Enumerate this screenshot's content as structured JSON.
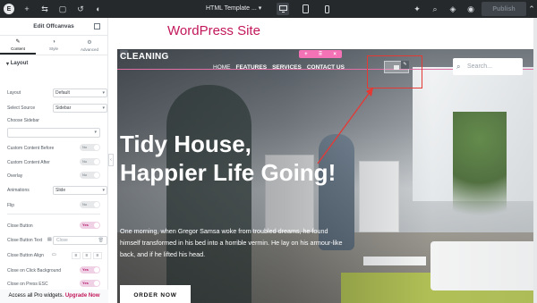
{
  "topbar": {
    "logo": "E",
    "title": "HTML Template ...",
    "publish_label": "Publish",
    "icons": [
      "elementor-logo-icon",
      "add-icon",
      "settings-sliders-icon",
      "page-icon",
      "history-icon",
      "contrast-icon",
      "desktop-icon",
      "tablet-icon",
      "mobile-icon",
      "notifications-icon",
      "search-icon",
      "layers-icon",
      "preview-eye-icon"
    ]
  },
  "panel": {
    "title": "Edit Offcanvas",
    "tabs": [
      {
        "label": "Content"
      },
      {
        "label": "Style"
      },
      {
        "label": "Advanced"
      }
    ],
    "section": "Layout",
    "rows": {
      "layout": {
        "label": "Layout",
        "value": "Default"
      },
      "select_source": {
        "label": "Select Source",
        "value": "Sidebar"
      },
      "choose_sidebar": {
        "label": "Choose Sidebar"
      },
      "custom_before": {
        "label": "Custom Content Before",
        "value": "No"
      },
      "custom_after": {
        "label": "Custom Content After",
        "value": "No"
      },
      "overlay": {
        "label": "Overlay",
        "value": "No"
      },
      "animations": {
        "label": "Animations",
        "value": "Slide"
      },
      "flip": {
        "label": "Flip",
        "value": "No"
      },
      "close_button": {
        "label": "Close Button",
        "value": "Yes"
      },
      "close_button_text": {
        "label": "Close Button Text",
        "placeholder": "Close"
      },
      "close_button_align": {
        "label": "Close Button Align"
      },
      "close_on_click_bg": {
        "label": "Close on Click Background",
        "value": "Yes"
      },
      "close_on_esc": {
        "label": "Close on Press ESC",
        "value": "Yes"
      }
    },
    "promo_text": "Access all Pro widgets.",
    "promo_link": "Upgrade Now"
  },
  "preview": {
    "label": "WordPress Site",
    "site_logo": "CLEANING",
    "nav": [
      "HOME",
      "FEATURES",
      "SERVICES",
      "CONTACT US"
    ],
    "search_placeholder": "Search...",
    "heading": "Tidy House, Happier Life Going!",
    "paragraph": "One morning, when Gregor Samsa woke from troubled dreams, he found himself transformed in his bed into a horrible vermin. He lay on his armour-like back, and if he lifted his head.",
    "cta": "ORDER NOW",
    "handle_glyphs": [
      "+",
      "⠿",
      "×"
    ]
  },
  "colors": {
    "accent": "#c2185b",
    "annotation": "#e53935",
    "topbar": "#26292c"
  }
}
